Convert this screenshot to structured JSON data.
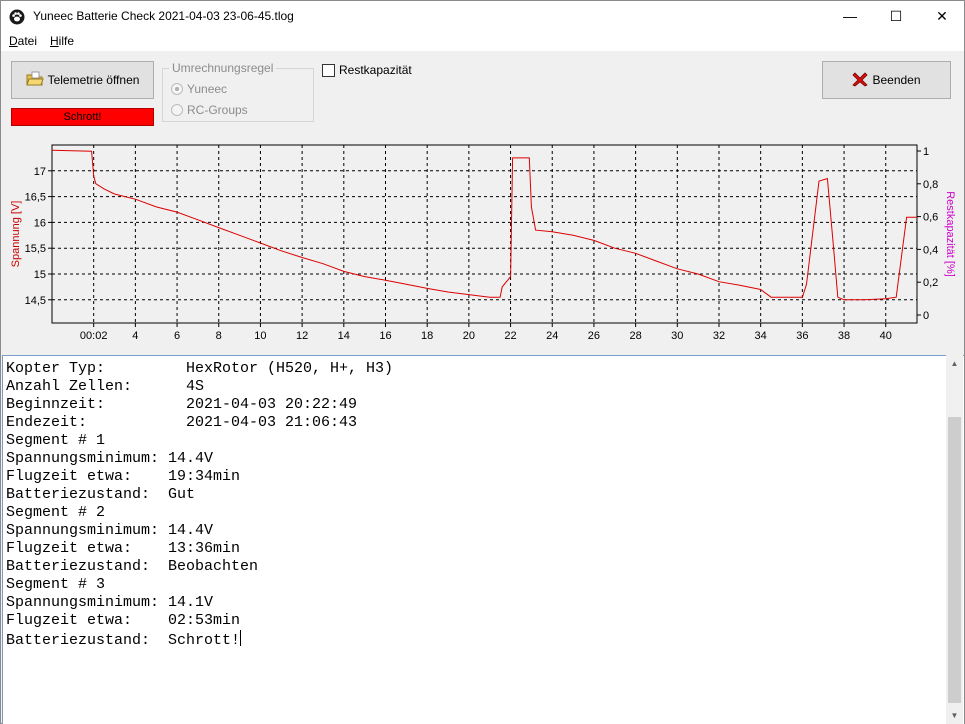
{
  "window": {
    "title": "Yuneec Batterie Check  2021-04-03 23-06-45.tlog",
    "minimize": "—",
    "maximize": "☐",
    "close": "✕"
  },
  "menu": {
    "items": [
      {
        "label": "Datei",
        "accel": "D"
      },
      {
        "label": "Hilfe",
        "accel": "H"
      }
    ]
  },
  "toolbar": {
    "open_label": "Telemetrie öffnen",
    "end_label": "Beenden",
    "status_text": "Schrott!",
    "status_color": "#ff0000",
    "group_title": "Umrechnungsregel",
    "radio_options": [
      {
        "label": "Yuneec",
        "checked": true
      },
      {
        "label": "RC-Groups",
        "checked": false
      }
    ],
    "checkbox_label": "Restkapazität",
    "checkbox_checked": false
  },
  "chart_data": {
    "type": "line",
    "ylabel": "Spannung [V]",
    "y2label": "Restkapazität [%]",
    "ylabel_color": "#cc0000",
    "y2label_color": "#cc00cc",
    "line_color": "#dd0000",
    "xlim": [
      0,
      41.5
    ],
    "ylim": [
      14.05,
      17.5
    ],
    "y2lim": [
      0,
      1
    ],
    "x_ticks": [
      "00:02",
      "4",
      "6",
      "8",
      "10",
      "12",
      "14",
      "16",
      "18",
      "20",
      "22",
      "24",
      "26",
      "28",
      "30",
      "32",
      "34",
      "36",
      "38",
      "40"
    ],
    "x_tick_values": [
      2,
      4,
      6,
      8,
      10,
      12,
      14,
      16,
      18,
      20,
      22,
      24,
      26,
      28,
      30,
      32,
      34,
      36,
      38,
      40
    ],
    "y_ticks": [
      "17",
      "16,5",
      "16",
      "15,5",
      "15",
      "14,5"
    ],
    "y_tick_values": [
      17,
      16.5,
      16,
      15.5,
      15,
      14.5
    ],
    "y2_ticks": [
      "1",
      "0,8",
      "0,6",
      "0,4",
      "0,2",
      "0"
    ],
    "y2_tick_values": [
      1,
      0.8,
      0.6,
      0.4,
      0.2,
      0
    ],
    "grid": true,
    "series": [
      {
        "x": [
          0,
          1.9,
          2.0,
          2.1,
          2.5,
          3,
          4,
          5,
          6,
          7,
          8,
          9,
          10,
          11,
          12,
          13,
          14,
          15,
          16,
          17,
          18,
          19,
          20,
          21,
          21.5,
          21.6,
          22.0,
          22.1,
          22.9,
          23.0,
          23.2,
          24,
          25,
          26,
          27,
          28,
          29,
          30,
          31,
          32,
          33,
          34,
          34.5,
          35,
          36,
          36.2,
          36.8,
          37.2,
          37.5,
          37.7,
          38,
          39,
          40,
          40.5,
          41,
          41.5
        ],
        "y": [
          17.4,
          17.38,
          16.9,
          16.75,
          16.65,
          16.55,
          16.45,
          16.3,
          16.2,
          16.05,
          15.9,
          15.75,
          15.6,
          15.45,
          15.32,
          15.2,
          15.05,
          14.95,
          14.88,
          14.8,
          14.72,
          14.65,
          14.6,
          14.55,
          14.55,
          14.75,
          14.95,
          17.25,
          17.25,
          16.3,
          15.85,
          15.82,
          15.75,
          15.65,
          15.5,
          15.4,
          15.25,
          15.1,
          15.0,
          14.85,
          14.78,
          14.7,
          14.55,
          14.55,
          14.55,
          14.8,
          16.8,
          16.85,
          15.5,
          14.55,
          14.5,
          14.5,
          14.52,
          14.55,
          16.1,
          16.1
        ]
      }
    ]
  },
  "log": {
    "lines": [
      "Kopter Typ:         HexRotor (H520, H+, H3)",
      "Anzahl Zellen:      4S",
      "Beginnzeit:         2021-04-03 20:22:49",
      "Endezeit:           2021-04-03 21:06:43",
      "",
      "Segment # 1",
      "Spannungsminimum: 14.4V",
      "Flugzeit etwa:    19:34min",
      "Batteriezustand:  Gut",
      "",
      "Segment # 2",
      "Spannungsminimum: 14.4V",
      "Flugzeit etwa:    13:36min",
      "Batteriezustand:  Beobachten",
      "",
      "Segment # 3",
      "Spannungsminimum: 14.1V",
      "Flugzeit etwa:    02:53min",
      "Batteriezustand:  Schrott!"
    ]
  }
}
